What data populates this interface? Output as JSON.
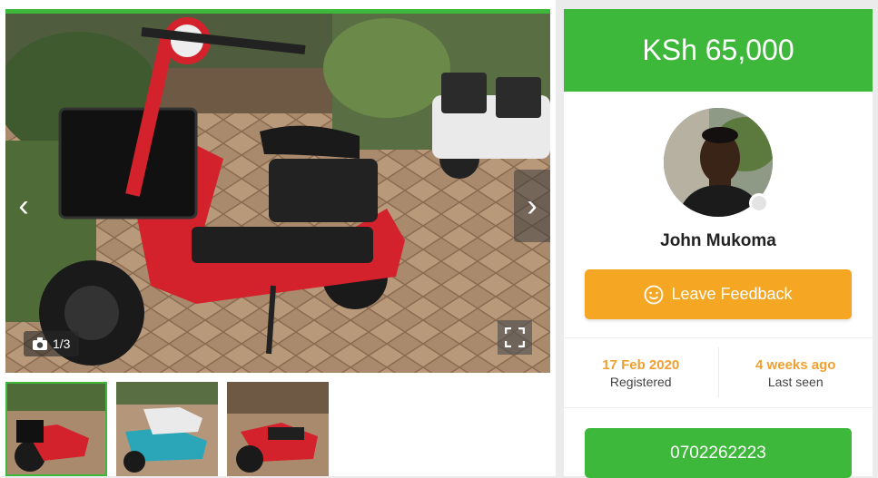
{
  "gallery": {
    "photo_counter": "1/3",
    "icons": {
      "prev": "chevron-left-icon",
      "next": "chevron-right-icon",
      "camera": "camera-icon",
      "fullscreen": "fullscreen-icon"
    },
    "thumbnails": [
      {
        "label": "thumbnail-1",
        "active": true
      },
      {
        "label": "thumbnail-2",
        "active": false
      },
      {
        "label": "thumbnail-3",
        "active": false
      }
    ]
  },
  "listing": {
    "price": "KSh 65,000"
  },
  "seller": {
    "name": "John Mukoma",
    "feedback_label": "Leave Feedback",
    "registered_value": "17 Feb 2020",
    "registered_label": "Registered",
    "last_seen_value": "4 weeks ago",
    "last_seen_label": "Last seen",
    "phone": "0702262223"
  },
  "colors": {
    "accent_green": "#3db83a",
    "feedback_orange": "#f5a623",
    "stat_orange": "#f0a030"
  }
}
